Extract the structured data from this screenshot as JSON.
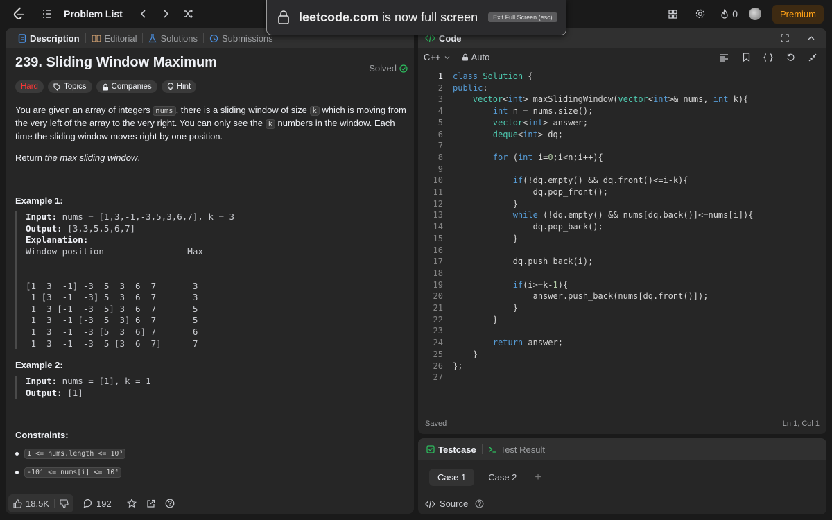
{
  "topbar": {
    "problem_list": "Problem List",
    "fire_count": "0",
    "premium": "Premium"
  },
  "fullscreen": {
    "domain": "leetcode.com",
    "message": " is now full screen",
    "exit": "Exit Full Screen (esc)"
  },
  "left_tabs": [
    "Description",
    "Editorial",
    "Solutions",
    "Submissions"
  ],
  "problem": {
    "title": "239. Sliding Window Maximum",
    "solved": "Solved",
    "difficulty": "Hard",
    "tags": [
      "Topics",
      "Companies",
      "Hint"
    ],
    "desc_1": "You are given an array of integers ",
    "desc_nums": "nums",
    "desc_2": ", there is a sliding window of size ",
    "desc_k": "k",
    "desc_3": " which is moving from the very left of the array to the very right. You can only see the ",
    "desc_k2": "k",
    "desc_4": " numbers in the window. Each time the sliding window moves right by one position.",
    "return_1": "Return ",
    "return_2": "the max sliding window",
    "return_3": ".",
    "example1_title": "Example 1:",
    "example1_input_label": "Input:",
    "example1_input": " nums = [1,3,-1,-3,5,3,6,7], k = 3",
    "example1_output_label": "Output:",
    "example1_output": " [3,3,5,5,6,7]",
    "example1_expl_label": "Explanation:",
    "example1_table": [
      "Window position                Max",
      "---------------               -----",
      "[1  3  -1] -3  5  3  6  7       3",
      " 1 [3  -1  -3] 5  3  6  7       3",
      " 1  3 [-1  -3  5] 3  6  7       5",
      " 1  3  -1 [-3  5  3] 6  7       5",
      " 1  3  -1  -3 [5  3  6] 7       6",
      " 1  3  -1  -3  5 [3  6  7]      7"
    ],
    "example2_title": "Example 2:",
    "example2_input_label": "Input:",
    "example2_input": " nums = [1], k = 1",
    "example2_output_label": "Output:",
    "example2_output": " [1]",
    "constraints_title": "Constraints:",
    "constraints": [
      "1 <= nums.length <= 10⁵",
      "-10⁴ <= nums[i] <= 10⁴"
    ]
  },
  "left_footer": {
    "likes": "18.5K",
    "comments": "192"
  },
  "code_panel": {
    "title": "Code",
    "language": "C++",
    "mode": "Auto",
    "status": "Saved",
    "cursor": "Ln 1, Col 1"
  },
  "code_lines": [
    "class Solution {",
    "public:",
    "    vector<int> maxSlidingWindow(vector<int>& nums, int k){",
    "        int n = nums.size();",
    "        vector<int> answer;",
    "        deque<int> dq;",
    "",
    "        for (int i=0;i<n;i++){",
    "",
    "            if(!dq.empty() && dq.front()<=i-k){",
    "                dq.pop_front();",
    "            }",
    "            while (!dq.empty() && nums[dq.back()]<=nums[i]){",
    "                dq.pop_back();",
    "            }",
    "",
    "            dq.push_back(i);",
    "",
    "            if(i>=k-1){",
    "                answer.push_back(nums[dq.front()]);",
    "            }",
    "        }",
    "",
    "        return answer;",
    "    }",
    "};",
    ""
  ],
  "test_panel": {
    "testcase": "Testcase",
    "test_result": "Test Result",
    "cases": [
      "Case 1",
      "Case 2"
    ],
    "add": "+",
    "source": "Source"
  }
}
